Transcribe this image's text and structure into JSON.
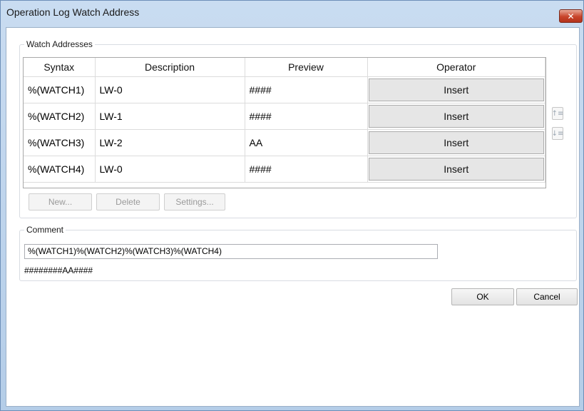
{
  "window": {
    "title": "Operation Log Watch Address",
    "close_glyph": "✕"
  },
  "watch_group": {
    "label": "Watch Addresses"
  },
  "table": {
    "headers": [
      "Syntax",
      "Description",
      "Preview",
      "Operator"
    ],
    "rows": [
      {
        "syntax": "%(WATCH1)",
        "description": "LW-0",
        "preview": "####",
        "operator": "Insert"
      },
      {
        "syntax": "%(WATCH2)",
        "description": "LW-1",
        "preview": "####",
        "operator": "Insert"
      },
      {
        "syntax": "%(WATCH3)",
        "description": "LW-2",
        "preview": "AA",
        "operator": "Insert"
      },
      {
        "syntax": "%(WATCH4)",
        "description": "LW-0",
        "preview": "####",
        "operator": "Insert"
      }
    ]
  },
  "toolbar": {
    "new_label": "New...",
    "delete_label": "Delete",
    "settings_label": "Settings..."
  },
  "side_buttons": {
    "move_up_icon": "move-up-icon",
    "move_down_icon": "move-down-icon"
  },
  "comment_group": {
    "label": "Comment",
    "value": "%(WATCH1)%(WATCH2)%(WATCH3)%(WATCH4)",
    "preview": "########AA####"
  },
  "footer": {
    "ok_label": "OK",
    "cancel_label": "Cancel"
  }
}
